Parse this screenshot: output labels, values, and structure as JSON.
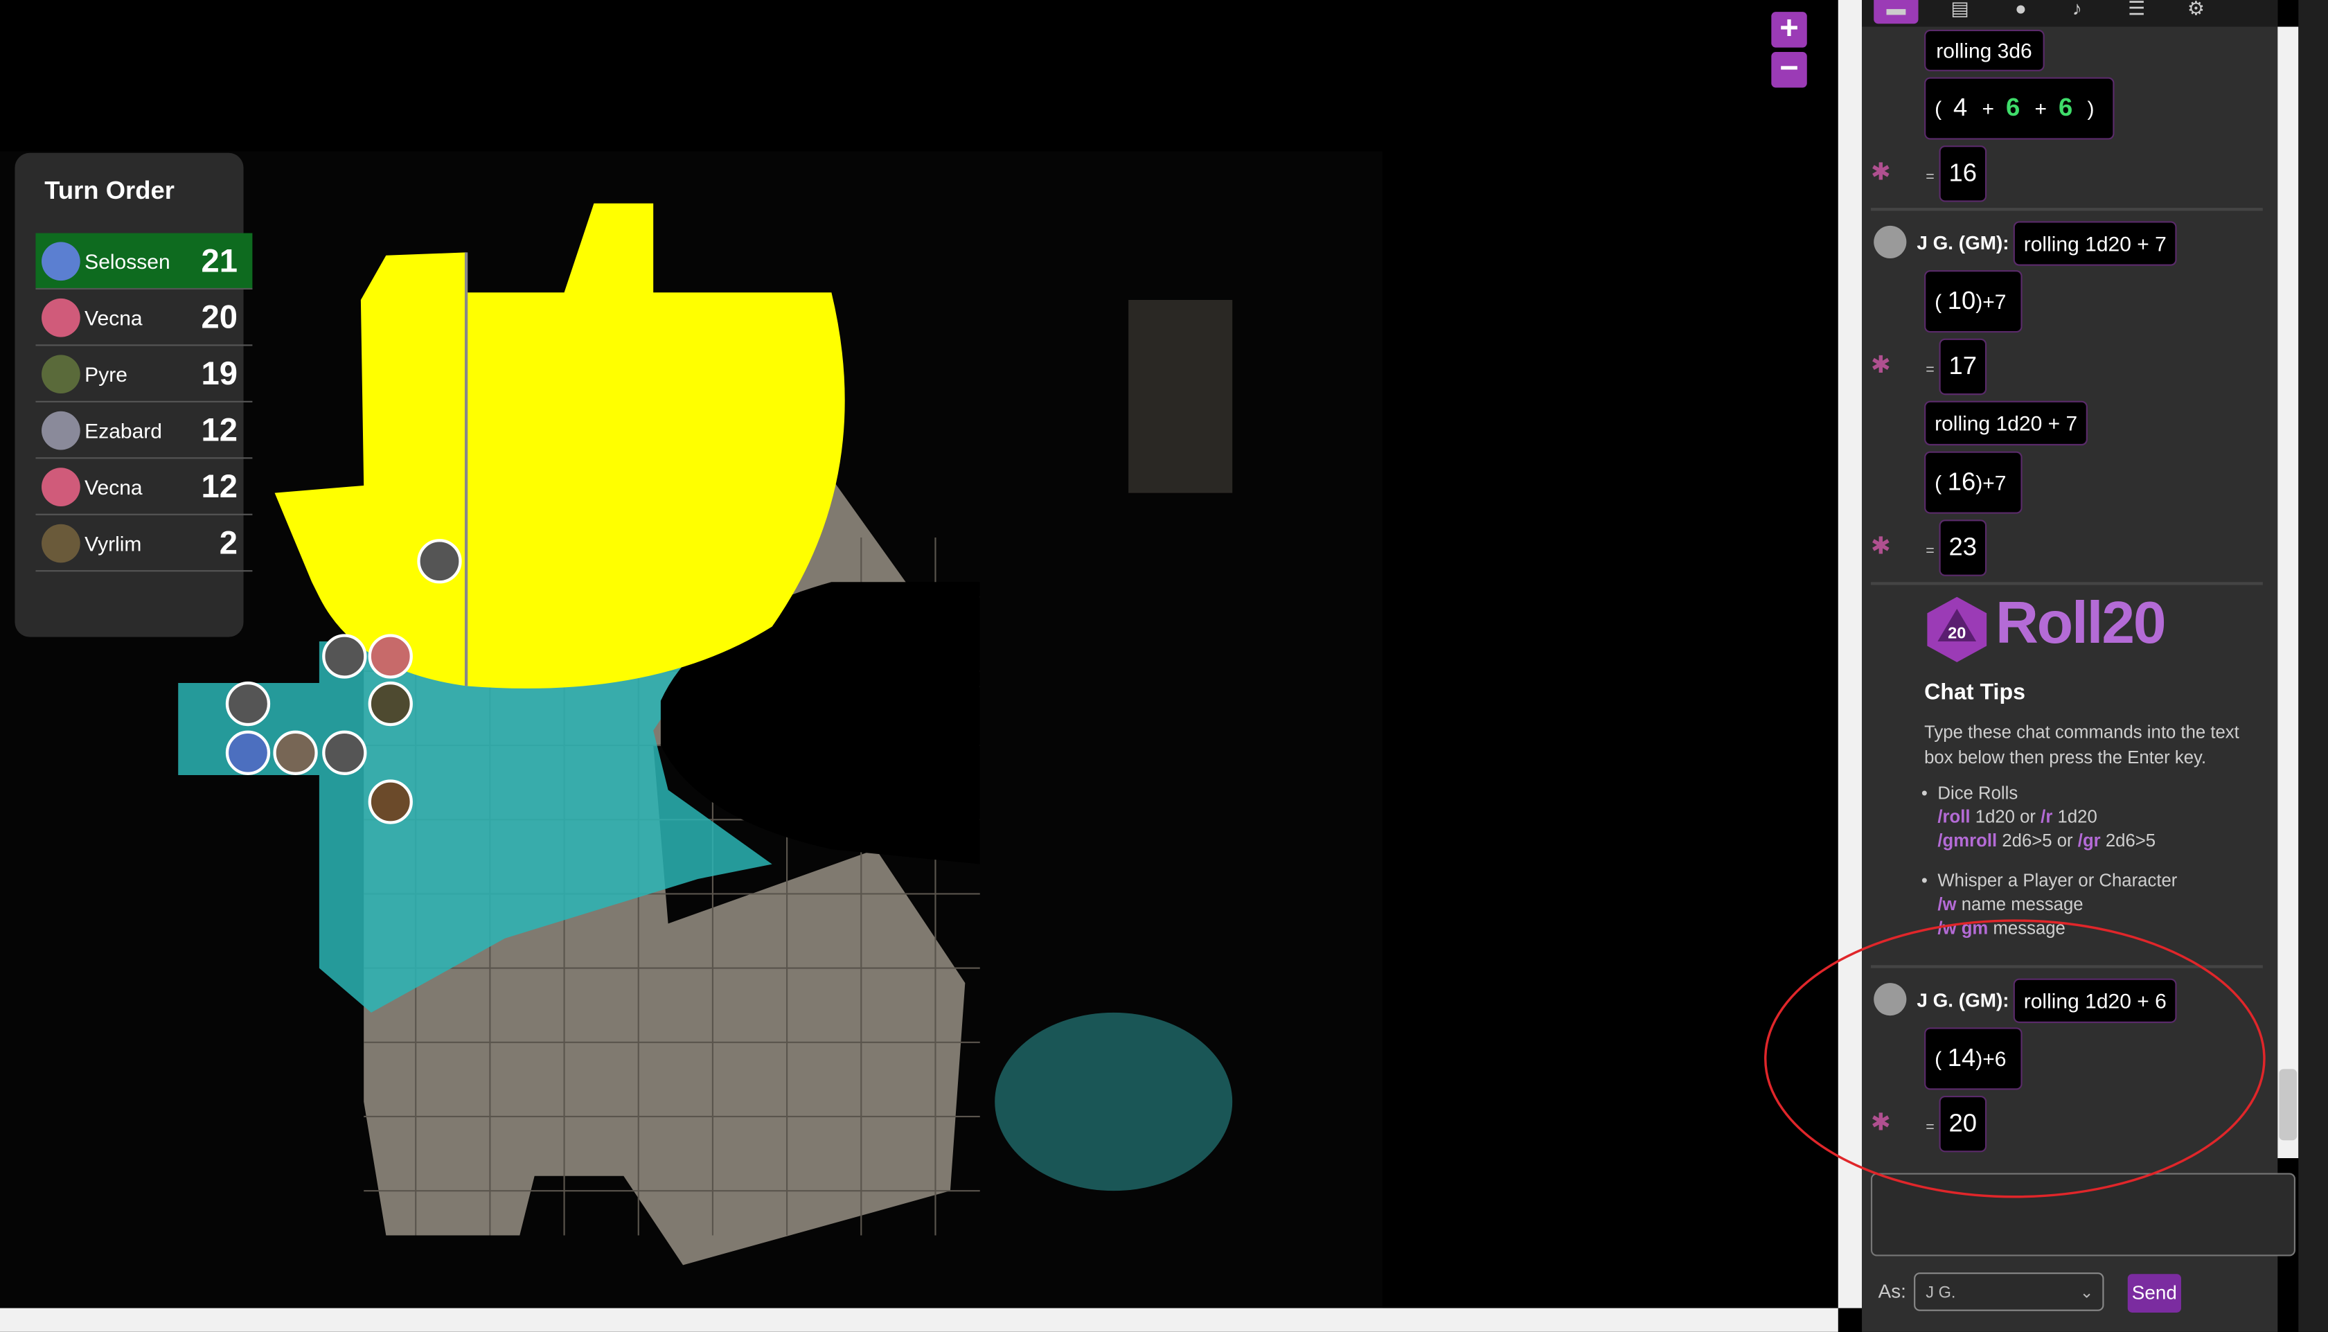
{
  "turn_order": {
    "title": "Turn Order",
    "entries": [
      {
        "name": "Selossen",
        "init": "21"
      },
      {
        "name": "Vecna",
        "init": "20"
      },
      {
        "name": "Pyre",
        "init": "19"
      },
      {
        "name": "Ezabard",
        "init": "12"
      },
      {
        "name": "Vecna",
        "init": "12"
      },
      {
        "name": "Vyrlim",
        "init": "2"
      }
    ]
  },
  "zoom": {
    "in": "+",
    "out": "−"
  },
  "chat": {
    "roll1": {
      "label": "rolling 3d6",
      "dice": [
        "4",
        "6",
        "6"
      ],
      "total": "16"
    },
    "msg2": {
      "sender": "J G. (GM):",
      "label": "rolling 1d20 + 7",
      "die": "10",
      "mod": ")+7",
      "total": "17"
    },
    "msg3": {
      "label": "rolling 1d20 + 7",
      "die": "16",
      "mod": ")+7",
      "total": "23"
    },
    "tips": {
      "logo": "Roll20",
      "title": "Chat Tips",
      "intro": "Type these chat commands into the text box below then press the Enter key.",
      "dice_title": "Dice Rolls",
      "dice_line1_cmd": "/roll",
      "dice_line1": "1d20 or",
      "dice_line1_cmd2": "/r",
      "dice_line1_b": "1d20",
      "dice_line2_cmd": "/gmroll",
      "dice_line2": "2d6>5 or",
      "dice_line2_cmd2": "/gr",
      "dice_line2_b": "2d6>5",
      "whisper_title": "Whisper a Player or Character",
      "w1_cmd": "/w",
      "w1": "name message",
      "w2_cmd": "/w gm",
      "w2": "message"
    },
    "msg4": {
      "sender": "J G. (GM):",
      "label": "rolling 1d20 + 6",
      "die": "14",
      "mod": ")+6",
      "total": "20"
    }
  },
  "compose": {
    "as_label": "As:",
    "as_value": "J G.",
    "send": "Send"
  },
  "colors": {
    "accent": "#9b3bb6",
    "fog_yellow": "#ffff00",
    "water": "#2bb5b5",
    "annotation": "#e0262a"
  }
}
